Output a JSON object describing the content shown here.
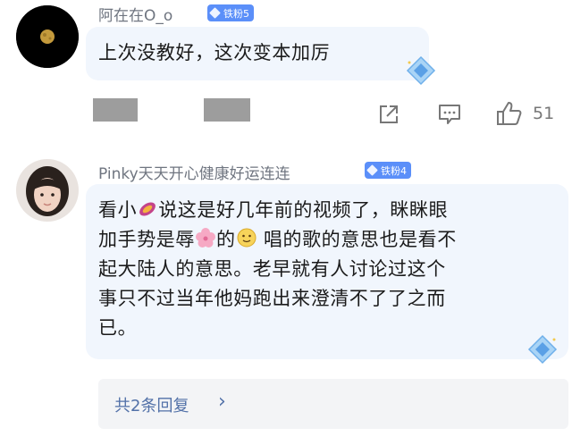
{
  "comment1": {
    "username": "阿在在O_o",
    "badge": "铁粉5",
    "text": "上次没教好，这次变本加厉",
    "like_count": "51",
    "icons": [
      "moon-avatar",
      "share-icon",
      "comment-icon",
      "thumbs-up-icon",
      "diamond-sticker-icon"
    ]
  },
  "comment2": {
    "username": "Pinky天天开心健康好运连连",
    "badge": "铁粉4",
    "text_parts": [
      "看小",
      "说这是好几年前的视频了，眯眯眼",
      "加手势是辱",
      "的",
      " 唱的歌的意思也是看不",
      "起大陆人的意思。老早就有人讨论过这个",
      "事只不过当年他妈跑出来澄清不了了之而",
      "已。"
    ],
    "icons": [
      "sweet-potato-emoji",
      "flower-emoji",
      "smile-emoji",
      "diamond-sticker-icon"
    ]
  },
  "replies": {
    "label": "共2条回复",
    "chevron": "›"
  },
  "colors": {
    "bubble": "#f1f6fd",
    "badge": "#5b8ff9",
    "replies_link": "#5271a8"
  }
}
